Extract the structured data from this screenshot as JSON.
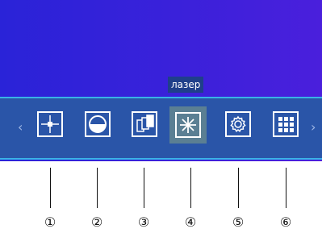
{
  "tooltip": {
    "text": "лазер"
  },
  "toolbar": {
    "left_arrow": "‹",
    "right_arrow": "›",
    "tools": [
      {
        "icon": "crosshair-icon",
        "active": false
      },
      {
        "icon": "half-circle-icon",
        "active": false
      },
      {
        "icon": "layers-icon",
        "active": false
      },
      {
        "icon": "laser-star-icon",
        "active": true
      },
      {
        "icon": "gear-icon",
        "active": false
      },
      {
        "icon": "grid-icon",
        "active": false
      }
    ]
  },
  "callouts": [
    "①",
    "②",
    "③",
    "④",
    "⑤",
    "⑥"
  ],
  "colors": {
    "screen": "#3a21da",
    "toolbar": "#2a55a8",
    "toolbar_border": "#39b3e6",
    "active_tool": "#5b7f93",
    "tooltip": "#1f3f8a"
  }
}
